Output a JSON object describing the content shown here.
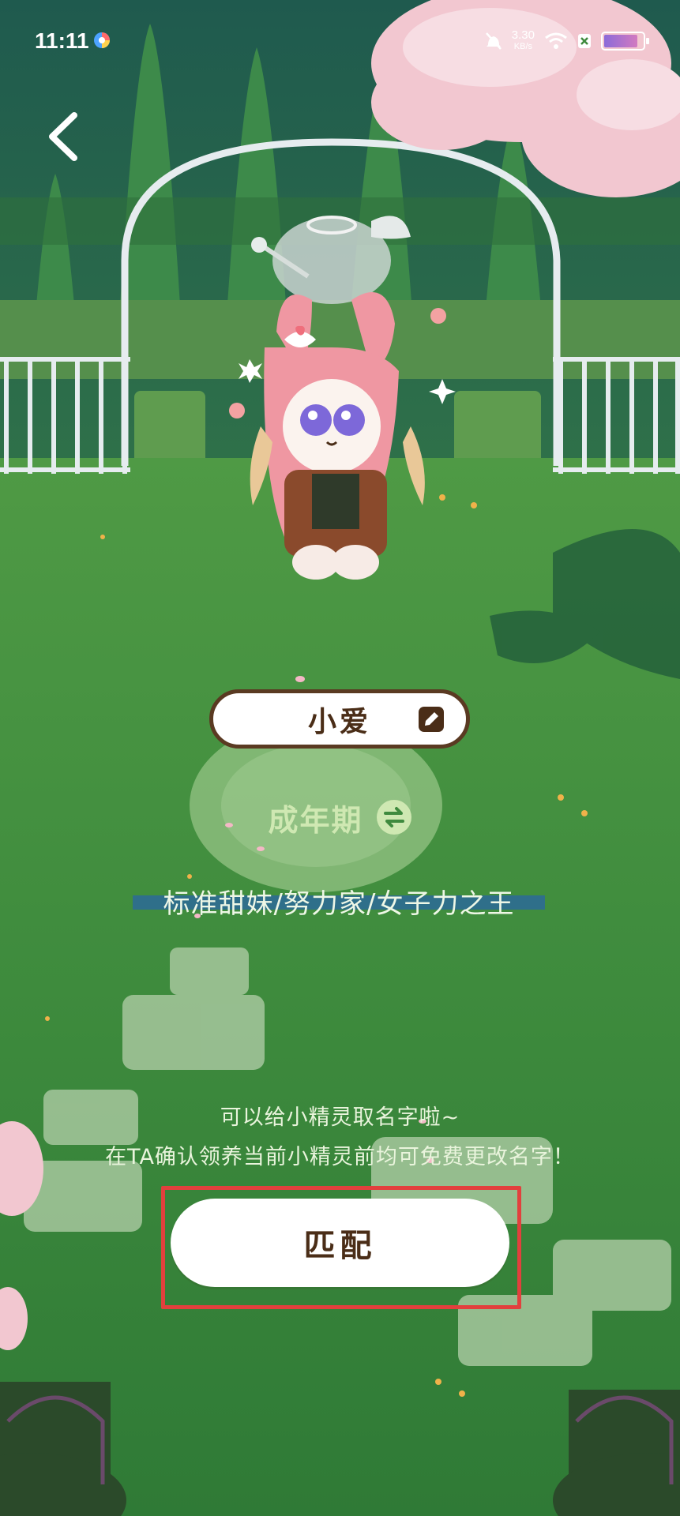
{
  "status_bar": {
    "time": "11:11",
    "net_speed_value": "3.30",
    "net_speed_unit": "KB/s",
    "icons": [
      "app-icon",
      "mute-icon",
      "network-speed",
      "wifi-icon",
      "sim-icon",
      "battery-icon"
    ]
  },
  "header": {
    "back_icon": "chevron-left-icon"
  },
  "sprite": {
    "name": "小爱",
    "stage": "成年期",
    "tags": "标准甜妹/努力家/女子力之王"
  },
  "hint": {
    "line1": "可以给小精灵取名字啦~",
    "line2": "在TA确认领养当前小精灵前均可免费更改名字！"
  },
  "actions": {
    "match_label": "匹配"
  },
  "colors": {
    "brown": "#5a3a22",
    "grass": "#3f8a3e",
    "highlight_red": "#e2403d",
    "stage_text": "#cfe8b2"
  }
}
